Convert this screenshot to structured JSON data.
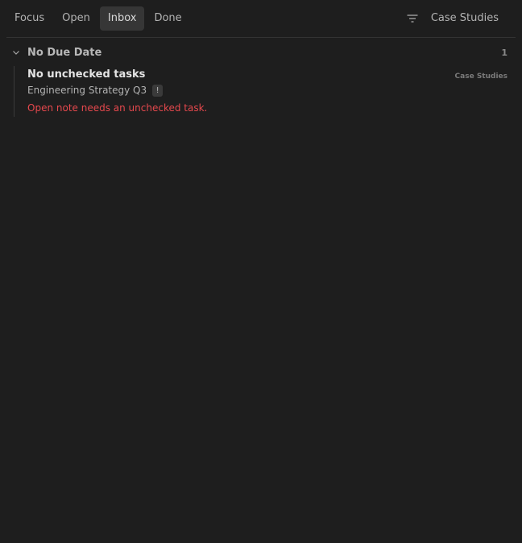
{
  "toolbar": {
    "tabs": [
      {
        "label": "Focus"
      },
      {
        "label": "Open"
      },
      {
        "label": "Inbox"
      },
      {
        "label": "Done"
      }
    ],
    "active_tab": "Inbox",
    "filter_icon": "filter-icon",
    "scope_label": "Case Studies"
  },
  "groups": [
    {
      "title": "No Due Date",
      "count": "1",
      "collapse_icon": "chevron-down-icon",
      "tasks": [
        {
          "title": "No unchecked tasks",
          "source_badge": "Case Studies",
          "note": "Engineering Strategy Q3",
          "flag": "!",
          "warning": "Open note needs an unchecked task."
        }
      ]
    }
  ],
  "colors": {
    "background": "#1e1e1e",
    "active_tab": "#363636",
    "warning": "#e5484d"
  }
}
